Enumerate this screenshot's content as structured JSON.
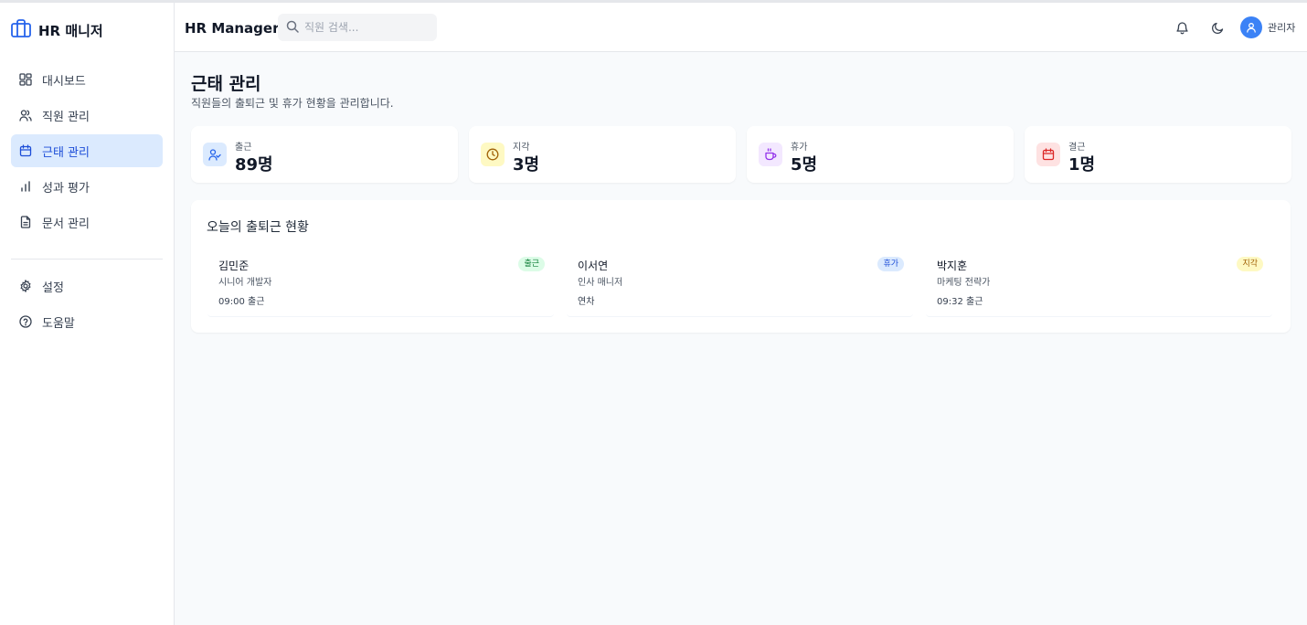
{
  "app": {
    "brand": "HR 매니저",
    "header_title": "HR Manager"
  },
  "colors": {
    "accent": "#3b82f6",
    "active_bg": "#dbeafe",
    "active_text": "#1d4ed8"
  },
  "sidebar": {
    "items": [
      {
        "label": "대시보드",
        "icon": "grid-icon"
      },
      {
        "label": "직원 관리",
        "icon": "users-icon"
      },
      {
        "label": "근태 관리",
        "icon": "calendar-icon",
        "active": true
      },
      {
        "label": "성과 평가",
        "icon": "bar-chart-icon"
      },
      {
        "label": "문서 관리",
        "icon": "file-icon"
      }
    ],
    "bottom": [
      {
        "label": "설정",
        "icon": "gear-icon"
      },
      {
        "label": "도움말",
        "icon": "help-icon"
      }
    ]
  },
  "header": {
    "search_placeholder": "직원 검색...",
    "user_name": "관리자"
  },
  "page": {
    "title": "근태 관리",
    "subtitle": "직원들의 출퇴근 및 휴가 현황을 관리합니다."
  },
  "stats": [
    {
      "label": "출근",
      "value": "89명",
      "icon": "user-check-icon",
      "bg": "#dbeafe",
      "color": "#2563eb"
    },
    {
      "label": "지각",
      "value": "3명",
      "icon": "clock-icon",
      "bg": "#fef9c3",
      "color": "#a16207"
    },
    {
      "label": "휴가",
      "value": "5명",
      "icon": "coffee-icon",
      "bg": "#f3e8ff",
      "color": "#9333ea"
    },
    {
      "label": "결근",
      "value": "1명",
      "icon": "calendar-icon",
      "bg": "#fee2e2",
      "color": "#dc2626"
    }
  ],
  "today": {
    "title": "오늘의 출퇴근 현황",
    "employees": [
      {
        "name": "김민준",
        "role": "시니어 개발자",
        "time": "09:00 출근",
        "status": "출근",
        "status_bg": "#dcfce7",
        "status_color": "#15803d"
      },
      {
        "name": "이서연",
        "role": "인사 매니저",
        "time": "연차",
        "status": "휴가",
        "status_bg": "#dbeafe",
        "status_color": "#1d4ed8"
      },
      {
        "name": "박지훈",
        "role": "마케팅 전략가",
        "time": "09:32 출근",
        "status": "지각",
        "status_bg": "#fef9c3",
        "status_color": "#a16207"
      }
    ]
  }
}
